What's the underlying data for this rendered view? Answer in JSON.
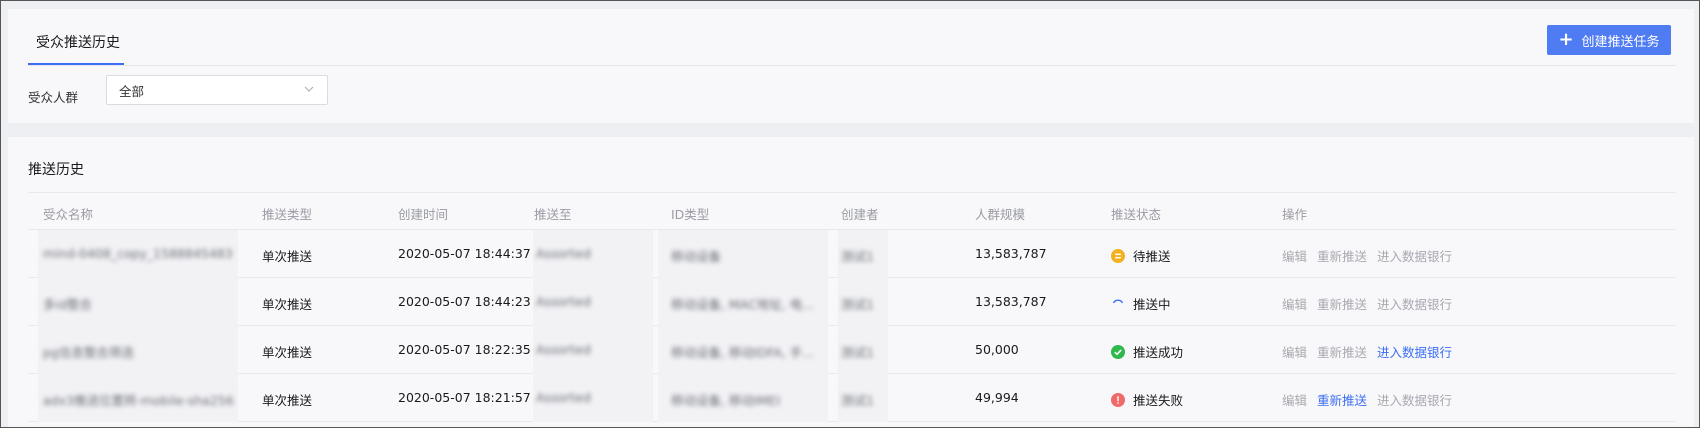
{
  "tabs": [
    {
      "label": "受众推送历史"
    }
  ],
  "header": {
    "create_button": "创建推送任务"
  },
  "filter": {
    "label": "受众人群",
    "selected": "全部"
  },
  "section": {
    "title": "推送历史"
  },
  "table": {
    "columns": [
      "受众名称",
      "推送类型",
      "创建时间",
      "推送至",
      "ID类型",
      "创建者",
      "人群规模",
      "推送状态",
      "操作"
    ],
    "rows": [
      {
        "name": "mind-0408_copy_1588845483",
        "type": "单次推送",
        "created": "2020-05-07 18:44:37",
        "target": "Assorted",
        "id_type": "移动设备",
        "creator": "测试1",
        "size": "13,583,787",
        "status": "待推送",
        "status_color": "#f5b021",
        "ops": [
          "编辑",
          "重新推送",
          "进入数据银行"
        ],
        "ops_active": [
          false,
          false,
          false
        ]
      },
      {
        "name": "多id整合",
        "type": "单次推送",
        "created": "2020-05-07 18:44:23",
        "target": "Assorted",
        "id_type": "移动设备, MAC地址, 电...",
        "creator": "测试1",
        "size": "13,583,787",
        "status": "推送中",
        "status_color": "#3b6ef5",
        "ops": [
          "编辑",
          "重新推送",
          "进入数据银行"
        ],
        "ops_active": [
          false,
          false,
          false
        ]
      },
      {
        "name": "pg信息整合筛选",
        "type": "单次推送",
        "created": "2020-05-07 18:22:35",
        "target": "Assorted",
        "id_type": "移动设备, 移动IDFA, 手...",
        "creator": "测试1",
        "size": "50,000",
        "status": "推送成功",
        "status_color": "#2fb84b",
        "ops": [
          "编辑",
          "重新推送",
          "进入数据银行"
        ],
        "ops_active": [
          false,
          false,
          true
        ]
      },
      {
        "name": "adx3推送位置转-mobile-sha256",
        "type": "单次推送",
        "created": "2020-05-07 18:21:57",
        "target": "Assorted",
        "id_type": "移动设备, 移动IMEI",
        "creator": "测试1",
        "size": "49,994",
        "status": "推送失败",
        "status_color": "#f06a6a",
        "ops": [
          "编辑",
          "重新推送",
          "进入数据银行"
        ],
        "ops_active": [
          false,
          true,
          false
        ]
      }
    ]
  }
}
